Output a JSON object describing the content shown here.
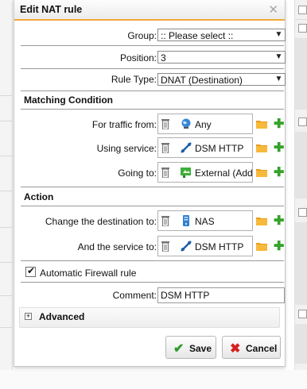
{
  "dialog": {
    "title": "Edit NAT rule"
  },
  "fields": {
    "group": {
      "label": "Group:",
      "value": ":: Please select ::"
    },
    "position": {
      "label": "Position:",
      "value": "3"
    },
    "rule_type": {
      "label": "Rule Type:",
      "value": "DNAT (Destination)"
    }
  },
  "matching": {
    "heading": "Matching Condition",
    "traffic_from": {
      "label": "For traffic from:",
      "value": "Any",
      "icon": "globe-network-icon"
    },
    "using_service": {
      "label": "Using service:",
      "value": "DSM HTTP",
      "icon": "service-connector-icon"
    },
    "going_to": {
      "label": "Going to:",
      "value": "External (Add",
      "icon": "external-interface-icon"
    }
  },
  "action": {
    "heading": "Action",
    "change_destination": {
      "label": "Change the destination to:",
      "value": "NAS",
      "icon": "host-device-icon"
    },
    "and_service": {
      "label": "And the service to:",
      "value": "DSM HTTP",
      "icon": "service-connector-icon"
    }
  },
  "auto_firewall": {
    "label": "Automatic Firewall rule",
    "checked": true
  },
  "comment": {
    "label": "Comment:",
    "value": "DSM HTTP"
  },
  "advanced": {
    "label": "Advanced",
    "expanded": false
  },
  "buttons": {
    "save": "Save",
    "cancel": "Cancel"
  },
  "colors": {
    "accent": "#f3a93a",
    "add_green": "#34a32a",
    "cancel_red": "#d62020",
    "save_green": "#2e9a2e"
  }
}
